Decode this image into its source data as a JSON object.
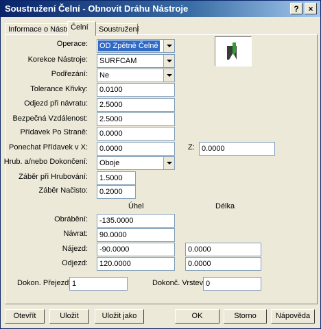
{
  "window": {
    "title": "Soustružení Čelní - Obnovit Dráhu Nástroje",
    "help_glyph": "?",
    "close_glyph": "×"
  },
  "tabs": [
    {
      "label": "Informace o Nástroji"
    },
    {
      "label": "Čelní"
    },
    {
      "label": "Soustružení"
    }
  ],
  "form": {
    "operace": {
      "label": "Operace:",
      "value": "OD Zpětně Čelně"
    },
    "korekce": {
      "label": "Korekce Nástroje:",
      "value": "SURFCAM"
    },
    "podrezani": {
      "label": "Podřezání:",
      "value": "Ne"
    },
    "tolerance": {
      "label": "Tolerance Křivky:",
      "value": "0.0100"
    },
    "odjezd_navratu": {
      "label": "Odjezd při návratu:",
      "value": "2.5000"
    },
    "bezpecna": {
      "label": "Bezpečná Vzdálenost:",
      "value": "2.5000"
    },
    "pridavek_strane": {
      "label": "Přídavek Po Straně:",
      "value": "0.0000"
    },
    "ponechat_x": {
      "label": "Ponechat Přídavek v X:",
      "value": "0.0000"
    },
    "ponechat_z": {
      "label": "Z:",
      "value": "0.0000"
    },
    "hrub_dokonceni": {
      "label": "Hrub. a/nebo Dokončení:",
      "value": "Oboje"
    },
    "zaber_hrub": {
      "label": "Záběr při Hrubování:",
      "value": "1.5000"
    },
    "zaber_nacisto": {
      "label": "Záběr Načisto:",
      "value": "0.2000"
    }
  },
  "grid": {
    "col_uhel": "Úhel",
    "col_delka": "Délka",
    "rows": [
      {
        "label": "Obrábění:",
        "uhel": "-135.0000",
        "delka": null
      },
      {
        "label": "Návrat:",
        "uhel": "90.0000",
        "delka": null
      },
      {
        "label": "Nájezd:",
        "uhel": "-90.0000",
        "delka": "0.0000"
      },
      {
        "label": "Odjezd:",
        "uhel": "120.0000",
        "delka": "0.0000"
      }
    ]
  },
  "bottom": {
    "dokon_prejezdy": {
      "label": "Dokon. Přejezdy:",
      "value": "1"
    },
    "dokonc_vrstev": {
      "label": "Dokonč. Vrstev:",
      "value": "0"
    }
  },
  "buttons": {
    "otevrit": "Otevřít",
    "ulozit": "Uložit",
    "ulozit_jako": "Uložit jako",
    "ok": "OK",
    "storno": "Storno",
    "napoveda": "Nápověda"
  },
  "icons": {
    "help": "help-icon",
    "close": "close-icon",
    "tool_preview": "facing-tool-preview-icon"
  },
  "colors": {
    "title_bar": "#0A246A",
    "dialog_bg": "#ECE9D8",
    "selection": "#316AC5",
    "tool_green": "#2E9E2E"
  }
}
